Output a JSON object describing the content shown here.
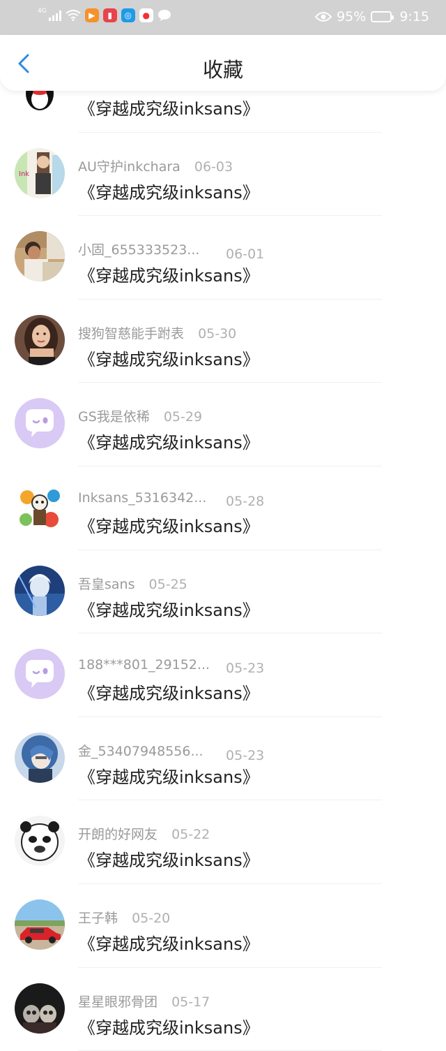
{
  "status_bar": {
    "network": "4G",
    "battery_pct": "95%",
    "time": "9:15"
  },
  "header": {
    "title": "收藏"
  },
  "items": [
    {
      "user": "",
      "date": "",
      "book": "《穿越成究级inksans》",
      "avatar": "penguin"
    },
    {
      "user": "AU守护inkchara",
      "date": "06-03",
      "book": "《穿越成究级inksans》",
      "avatar": "anime-art"
    },
    {
      "user": "小固_655333523...",
      "date": "06-01",
      "book": "《穿越成究级inksans》",
      "avatar": "photo-man"
    },
    {
      "user": "搜狗智慈能手跗表",
      "date": "05-30",
      "book": "《穿越成究级inksans》",
      "avatar": "photo-woman"
    },
    {
      "user": "GS我是依稀",
      "date": "05-29",
      "book": "《穿越成究级inksans》",
      "avatar": "default"
    },
    {
      "user": "Inksans_5316342...",
      "date": "05-28",
      "book": "《穿越成究级inksans》",
      "avatar": "colorful-art"
    },
    {
      "user": "吾皇sans",
      "date": "05-25",
      "book": "《穿越成究级inksans》",
      "avatar": "blue-anime"
    },
    {
      "user": "188***801_29152...",
      "date": "05-23",
      "book": "《穿越成究级inksans》",
      "avatar": "default"
    },
    {
      "user": "金_53407948556...",
      "date": "05-23",
      "book": "《穿越成究级inksans》",
      "avatar": "blue-hair-anime"
    },
    {
      "user": "开朗的好网友",
      "date": "05-22",
      "book": "《穿越成究级inksans》",
      "avatar": "panda-meme"
    },
    {
      "user": "王子韩",
      "date": "05-20",
      "book": "《穿越成究级inksans》",
      "avatar": "red-car"
    },
    {
      "user": "星星眼邪骨团",
      "date": "05-17",
      "book": "《穿越成究级inksans》",
      "avatar": "dark-art"
    }
  ],
  "colors": {
    "accent": "#2b8ae6",
    "default_avatar_bg": "#d9c9f5",
    "default_avatar_icon": "#b89be8"
  }
}
